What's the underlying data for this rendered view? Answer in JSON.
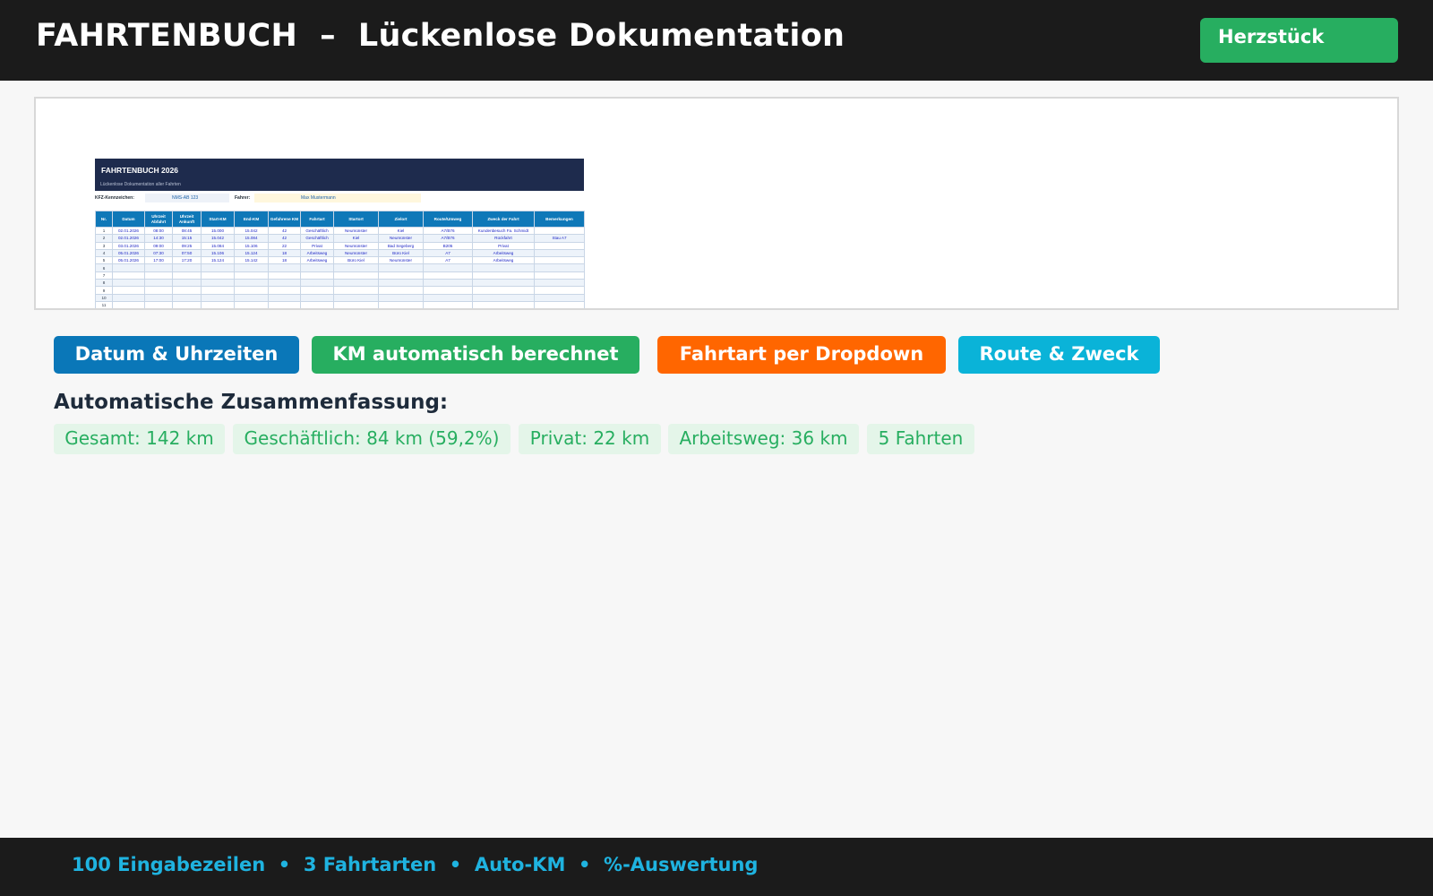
{
  "header": {
    "title": "FAHRTENBUCH  –  Lückenlose Dokumentation",
    "badge": "Herzstück"
  },
  "preview": {
    "sheet_title": "FAHRTENBUCH 2026",
    "sheet_subtitle": "Lückenlose Dokumentation aller Fahrten",
    "plate_label": "KFZ-Kennzeichen:",
    "plate_value": "NMS-AB 123",
    "driver_label": "Fahrer:",
    "driver_value": "Max Mustermann",
    "columns": [
      "Nr.",
      "Datum",
      "Uhrzeit Abfahrt",
      "Uhrzeit Ankunft",
      "Start-KM",
      "End-KM",
      "Gefahrene KM",
      "Fahrtart",
      "Startort",
      "Zielort",
      "Route/Umweg",
      "Zweck der Fahrt",
      "Bemerkungen"
    ],
    "rows": [
      [
        "1",
        "02.01.2026",
        "08:00",
        "08:45",
        "15.000",
        "15.042",
        "42",
        "Geschäftlich",
        "Neumünster",
        "Kiel",
        "A7/B76",
        "Kundenbesuch Fa. Schmidt",
        ""
      ],
      [
        "2",
        "02.01.2026",
        "14:30",
        "15:15",
        "15.042",
        "15.084",
        "42",
        "Geschäftlich",
        "Kiel",
        "Neumünster",
        "A7/B76",
        "Rückfahrt",
        "Stau A7"
      ],
      [
        "3",
        "03.01.2026",
        "09:00",
        "09:25",
        "15.084",
        "15.106",
        "22",
        "Privat",
        "Neumünster",
        "Bad Segeberg",
        "B205",
        "Privat",
        ""
      ],
      [
        "4",
        "05.01.2026",
        "07:30",
        "07:50",
        "15.106",
        "15.124",
        "18",
        "Arbeitsweg",
        "Neumünster",
        "Büro Kiel",
        "A7",
        "Arbeitsweg",
        ""
      ],
      [
        "5",
        "05.01.2026",
        "17:00",
        "17:20",
        "15.124",
        "15.142",
        "18",
        "Arbeitsweg",
        "Büro Kiel",
        "Neumünster",
        "A7",
        "Arbeitsweg",
        ""
      ],
      [
        "6",
        "",
        "",
        "",
        "",
        "",
        "",
        "",
        "",
        "",
        "",
        "",
        ""
      ],
      [
        "7",
        "",
        "",
        "",
        "",
        "",
        "",
        "",
        "",
        "",
        "",
        "",
        ""
      ],
      [
        "8",
        "",
        "",
        "",
        "",
        "",
        "",
        "",
        "",
        "",
        "",
        "",
        ""
      ],
      [
        "9",
        "",
        "",
        "",
        "",
        "",
        "",
        "",
        "",
        "",
        "",
        "",
        ""
      ],
      [
        "10",
        "",
        "",
        "",
        "",
        "",
        "",
        "",
        "",
        "",
        "",
        "",
        ""
      ],
      [
        "11",
        "",
        "",
        "",
        "",
        "",
        "",
        "",
        "",
        "",
        "",
        "",
        ""
      ]
    ]
  },
  "features": [
    {
      "label": "Datum & Uhrzeiten",
      "color": "#0a77b8"
    },
    {
      "label": "KM automatisch berechnet",
      "color": "#27ae60"
    },
    {
      "label": "Fahrtart per Dropdown",
      "color": "#ff6600"
    },
    {
      "label": "Route & Zweck",
      "color": "#0ab3d8"
    }
  ],
  "summary": {
    "title": "Automatische Zusammenfassung:",
    "stats": [
      "Gesamt: 142 km",
      "Geschäftlich: 84 km (59,2%)",
      "Privat: 22 km",
      "Arbeitsweg: 36 km",
      "5 Fahrten"
    ]
  },
  "footer": {
    "text": "100 Eingabezeilen  •  3 Fahrtarten  •  Auto-KM  •  %-Auswertung"
  }
}
